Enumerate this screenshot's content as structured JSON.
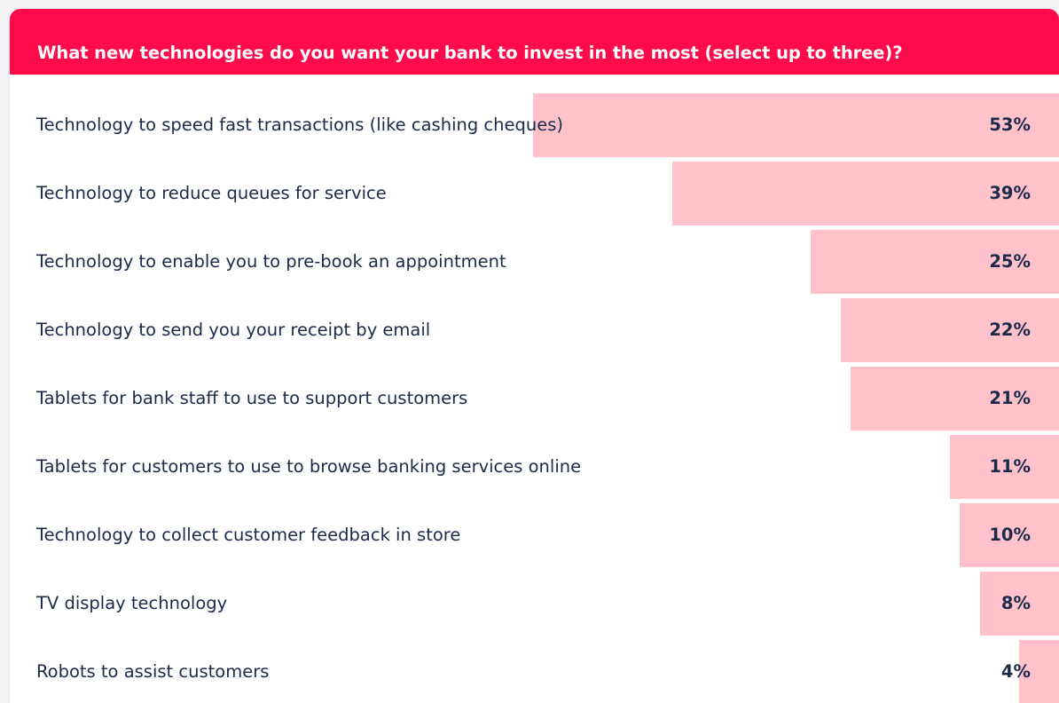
{
  "colors": {
    "header": "#ff0a4a",
    "bar": "#ffc2cb",
    "text": "#1c2a4a",
    "title_text": "#ffffff"
  },
  "chart_data": {
    "type": "bar",
    "orientation": "horizontal",
    "title": "What new technologies do you want your bank to invest in the most (select up to three)?",
    "categories": [
      "Technology to speed fast transactions (like cashing cheques)",
      "Technology to reduce queues for service",
      "Technology to enable you to pre-book an appointment",
      "Technology to send you your receipt by email",
      "Tablets for bank staff to use to support customers",
      "Tablets for customers to use to browse banking services online",
      "Technology to collect customer feedback in store",
      "TV display technology",
      "Robots to assist customers"
    ],
    "values": [
      53,
      39,
      25,
      22,
      21,
      11,
      10,
      8,
      4
    ],
    "value_labels": [
      "53%",
      "39%",
      "25%",
      "22%",
      "21%",
      "11%",
      "10%",
      "8%",
      "4%"
    ],
    "xlim": [
      0,
      100
    ],
    "grid": false
  }
}
